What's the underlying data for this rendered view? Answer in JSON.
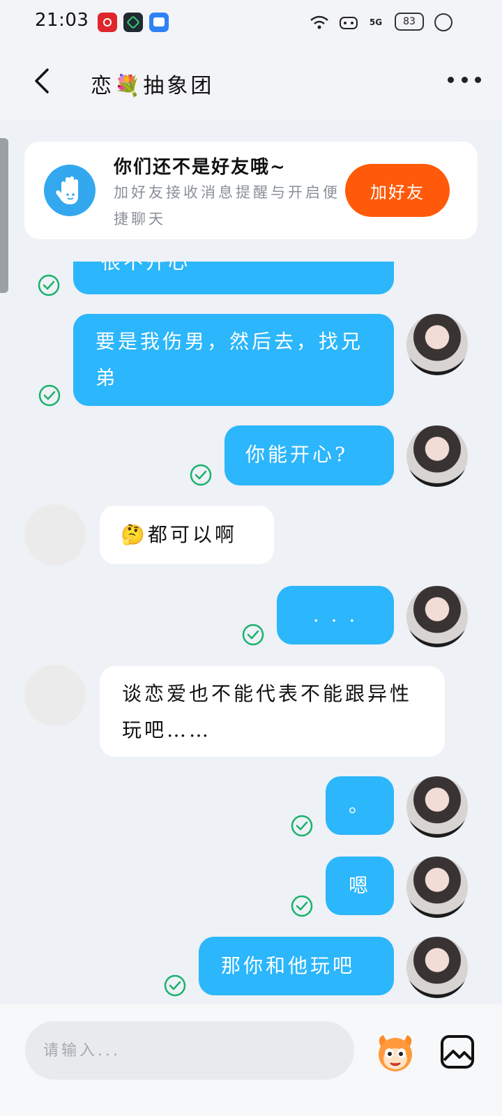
{
  "status_bar": {
    "time": "21:03",
    "network": "5G",
    "battery": "83"
  },
  "header": {
    "title": "恋💐抽象团"
  },
  "banner": {
    "title": "你们还不是好友哦~",
    "subtitle": "加好友接收消息提醒与开启便捷聊天",
    "button_label": "加好友"
  },
  "messages": [
    {
      "direction": "out",
      "text": "很不开心",
      "read": true
    },
    {
      "direction": "out",
      "text": "要是我伤男，然后去，找兄弟",
      "read": true
    },
    {
      "direction": "out",
      "text": "你能开心?",
      "read": true
    },
    {
      "direction": "in",
      "text": "🤔都可以啊"
    },
    {
      "direction": "out",
      "text": ". . .",
      "read": true
    },
    {
      "direction": "in",
      "text": "谈恋爱也不能代表不能跟异性玩吧……"
    },
    {
      "direction": "out",
      "text": "。",
      "read": true
    },
    {
      "direction": "out",
      "text": "嗯",
      "read": true
    },
    {
      "direction": "out",
      "text": "那你和他玩吧",
      "read": true
    }
  ],
  "input": {
    "placeholder": "请输入..."
  },
  "colors": {
    "outgoing_bubble": "#2cb6fb",
    "incoming_bubble": "#ffffff",
    "add_friend_button": "#ff5a0a",
    "read_check": "#19b26b",
    "background": "#eef1f6"
  }
}
